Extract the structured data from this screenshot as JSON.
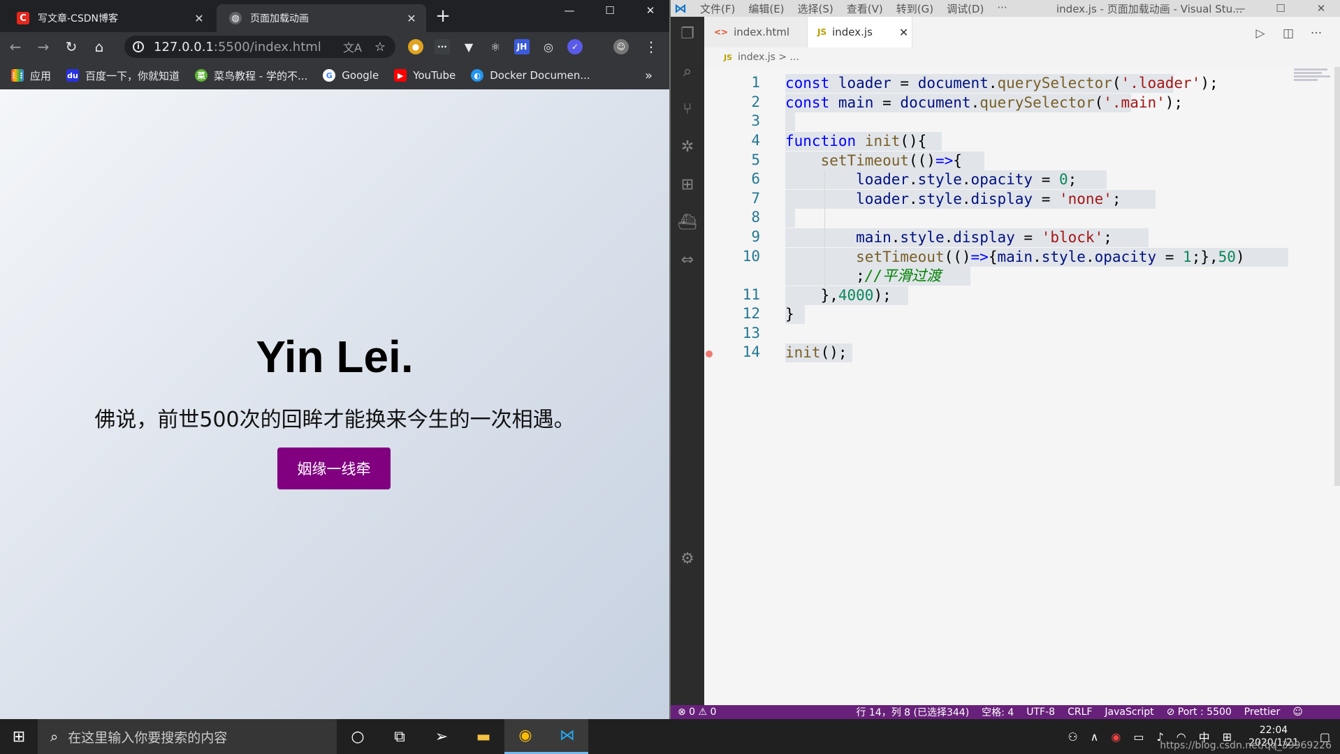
{
  "chrome": {
    "tabs": [
      {
        "title": "写文章-CSDN博客",
        "favicon": "C",
        "active": false
      },
      {
        "title": "页面加载动画",
        "favicon": "globe",
        "active": true
      }
    ],
    "address": {
      "host": "127.0.0.1",
      "path": ":5500/index.html"
    },
    "bookmarks": [
      {
        "label": "应用",
        "icon": "apps-icon"
      },
      {
        "label": "百度一下，你就知道",
        "icon": "baidu-icon"
      },
      {
        "label": "菜鸟教程 - 学的不...",
        "icon": "runoob-icon"
      },
      {
        "label": "Google",
        "icon": "google-icon"
      },
      {
        "label": "YouTube",
        "icon": "youtube-icon"
      },
      {
        "label": "Docker Documen...",
        "icon": "docker-icon"
      }
    ],
    "bookmarks_more": "»"
  },
  "page": {
    "title": "Yin Lei.",
    "subtitle": "佛说，前世500次的回眸才能换来今生的一次相遇。",
    "button": "姻缘一线牵",
    "button_color": "#800080"
  },
  "vscode": {
    "menu": [
      "文件(F)",
      "编辑(E)",
      "选择(S)",
      "查看(V)",
      "转到(G)",
      "调试(D)",
      "···"
    ],
    "window_title": "index.js - 页面加载动画 - Visual Stu...",
    "tabs": [
      {
        "label": "index.html",
        "icon": "<>",
        "active": false
      },
      {
        "label": "index.js",
        "icon": "JS",
        "active": true
      }
    ],
    "breadcrumb": {
      "file": "index.js",
      "rest": "> ..."
    },
    "line_numbers": [
      "1",
      "2",
      "3",
      "4",
      "5",
      "6",
      "7",
      "8",
      "9",
      "10",
      "",
      "11",
      "12",
      "13",
      "14"
    ],
    "status": {
      "problems": "⊗ 0 ⚠ 0",
      "position": "行 14，列 8 (已选择344)",
      "spaces": "空格: 4",
      "encoding": "UTF-8",
      "eol": "CRLF",
      "language": "JavaScript",
      "port": "⊘ Port : 5500",
      "formatter": "Prettier",
      "accent": "#68217a"
    }
  },
  "taskbar": {
    "search_placeholder": "在这里输入你要搜索的内容",
    "time": "22:04",
    "date": "2020/1/21",
    "ime": "中",
    "watermark": "https://blog.csdn.net/qq_39969226"
  }
}
